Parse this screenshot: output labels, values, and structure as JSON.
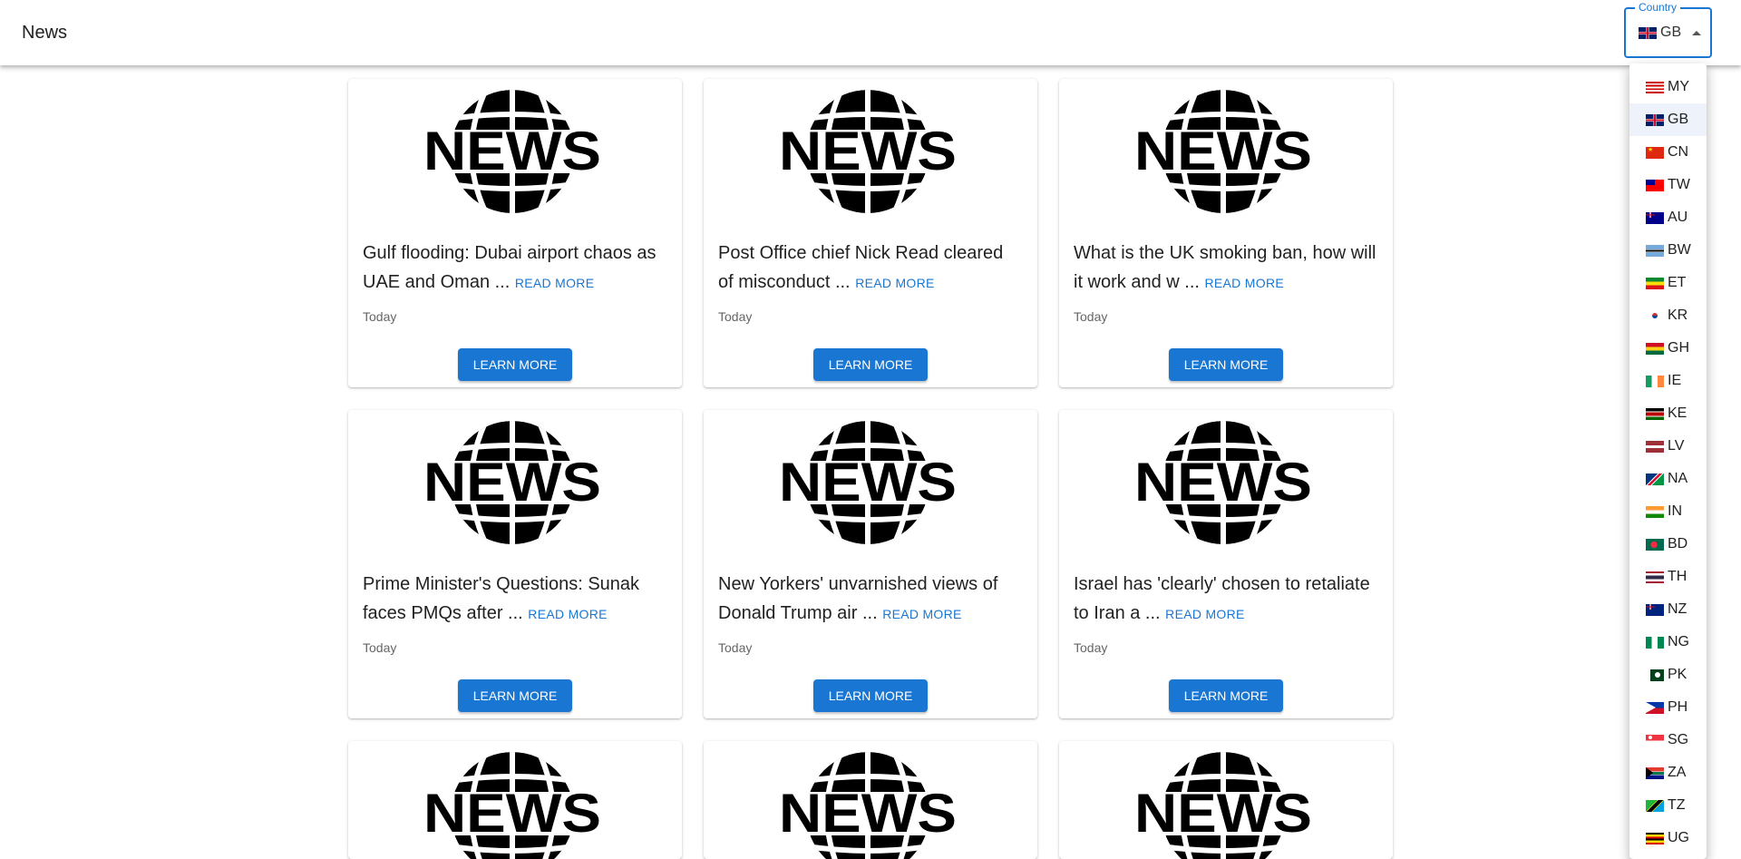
{
  "appbar": {
    "title": "News"
  },
  "country_select": {
    "label": "Country",
    "value": "GB",
    "value_flag": "GB"
  },
  "articles": [
    {
      "title": "Gulf flooding: Dubai airport chaos as UAE and Oman ...",
      "read_more": "READ MORE",
      "date": "Today",
      "button": "LEARN MORE",
      "image_text": "NEWS"
    },
    {
      "title": "Post Office chief Nick Read cleared of misconduct ...",
      "read_more": "READ MORE",
      "date": "Today",
      "button": "LEARN MORE",
      "image_text": "NEWS"
    },
    {
      "title": "What is the UK smoking ban, how will it work and w ...",
      "read_more": "READ MORE",
      "date": "Today",
      "button": "LEARN MORE",
      "image_text": "NEWS"
    },
    {
      "title": "Prime Minister's Questions: Sunak faces PMQs after ...",
      "read_more": "READ MORE",
      "date": "Today",
      "button": "LEARN MORE",
      "image_text": "NEWS"
    },
    {
      "title": "New Yorkers' unvarnished views of Donald Trump air ...",
      "read_more": "READ MORE",
      "date": "Today",
      "button": "LEARN MORE",
      "image_text": "NEWS"
    },
    {
      "title": "Israel has 'clearly' chosen to retaliate to Iran a ...",
      "read_more": "READ MORE",
      "date": "Today",
      "button": "LEARN MORE",
      "image_text": "NEWS"
    },
    {
      "title": "",
      "read_more": "",
      "date": "",
      "button": "",
      "image_text": "NEWS"
    },
    {
      "title": "",
      "read_more": "",
      "date": "",
      "button": "",
      "image_text": "NEWS"
    },
    {
      "title": "",
      "read_more": "",
      "date": "",
      "button": "",
      "image_text": "NEWS"
    }
  ],
  "country_menu": {
    "items": [
      {
        "code": "MY",
        "label": "MY",
        "selected": false
      },
      {
        "code": "GB",
        "label": "GB",
        "selected": true
      },
      {
        "code": "CN",
        "label": "CN",
        "selected": false
      },
      {
        "code": "TW",
        "label": "TW",
        "selected": false
      },
      {
        "code": "AU",
        "label": "AU",
        "selected": false
      },
      {
        "code": "BW",
        "label": "BW",
        "selected": false
      },
      {
        "code": "ET",
        "label": "ET",
        "selected": false
      },
      {
        "code": "KR",
        "label": "KR",
        "selected": false
      },
      {
        "code": "GH",
        "label": "GH",
        "selected": false
      },
      {
        "code": "IE",
        "label": "IE",
        "selected": false
      },
      {
        "code": "KE",
        "label": "KE",
        "selected": false
      },
      {
        "code": "LV",
        "label": "LV",
        "selected": false
      },
      {
        "code": "NA",
        "label": "NA",
        "selected": false
      },
      {
        "code": "IN",
        "label": "IN",
        "selected": false
      },
      {
        "code": "BD",
        "label": "BD",
        "selected": false
      },
      {
        "code": "TH",
        "label": "TH",
        "selected": false
      },
      {
        "code": "NZ",
        "label": "NZ",
        "selected": false
      },
      {
        "code": "NG",
        "label": "NG",
        "selected": false
      },
      {
        "code": "PK",
        "label": "PK",
        "selected": false
      },
      {
        "code": "PH",
        "label": "PH",
        "selected": false
      },
      {
        "code": "SG",
        "label": "SG",
        "selected": false
      },
      {
        "code": "ZA",
        "label": "ZA",
        "selected": false
      },
      {
        "code": "TZ",
        "label": "TZ",
        "selected": false
      },
      {
        "code": "UG",
        "label": "UG",
        "selected": false
      }
    ]
  },
  "colors": {
    "primary": "#1976d2",
    "selected_item_bg": "#eef3fb"
  }
}
